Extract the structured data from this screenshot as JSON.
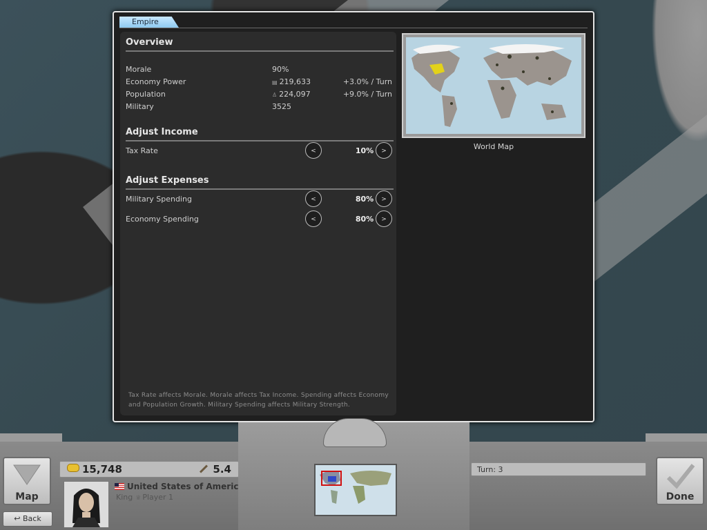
{
  "panel": {
    "tab_label": "Empire",
    "overview": {
      "title": "Overview",
      "rows": [
        {
          "label": "Morale",
          "value": "90%",
          "change": ""
        },
        {
          "label": "Economy Power",
          "value": "219,633",
          "change": "+3.0% / Turn"
        },
        {
          "label": "Population",
          "value": "224,097",
          "change": "+9.0% / Turn"
        },
        {
          "label": "Military",
          "value": "3525",
          "change": ""
        }
      ]
    },
    "income": {
      "title": "Adjust Income",
      "tax_label": "Tax Rate",
      "tax_value": "10%"
    },
    "expenses": {
      "title": "Adjust Expenses",
      "military_label": "Military Spending",
      "military_value": "80%",
      "economy_label": "Economy Spending",
      "economy_value": "80%"
    },
    "decrease_glyph": "<",
    "increase_glyph": ">",
    "footnote": "Tax Rate affects Morale. Morale affects Tax Income. Spending affects Economy and Population Growth. Military Spending affects Military Strength.",
    "world_map_label": "World Map"
  },
  "hud": {
    "map_button": "Map",
    "back_button": "↩ Back",
    "gold": "15,748",
    "strength": "5.4",
    "country": "United States of America",
    "rank": "King",
    "player": "Player 1",
    "turn": "Turn: 3",
    "done_button": "Done"
  },
  "colors": {
    "tab": "#8fcaf0",
    "panel_bg": "#1f1f1f",
    "player_territory": "#e3d21a",
    "ocean": "#b8d4e2"
  }
}
